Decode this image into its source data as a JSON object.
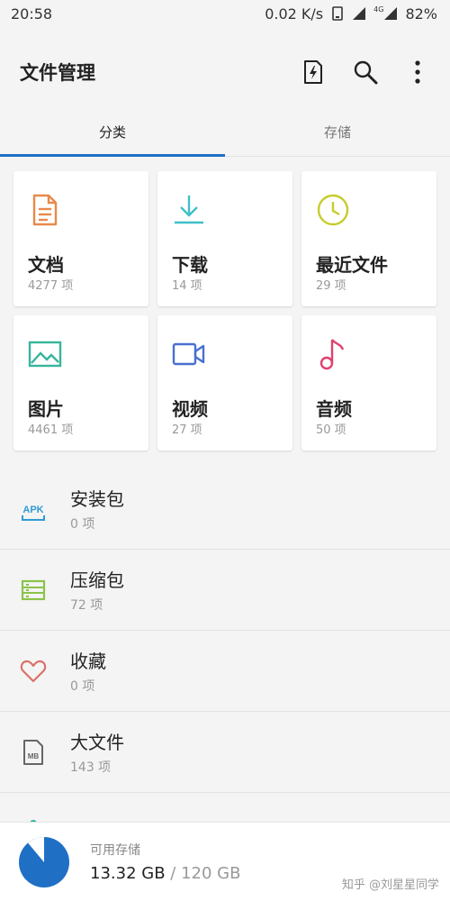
{
  "status_bar": {
    "time": "20:58",
    "speed": "0.02 K/s",
    "network": "4G",
    "battery": "82%"
  },
  "app_bar": {
    "title": "文件管理",
    "icons": [
      "flash-file-icon",
      "search-icon",
      "more-vert-icon"
    ]
  },
  "tabs": [
    {
      "label": "分类",
      "active": true
    },
    {
      "label": "存储",
      "active": false
    }
  ],
  "categories": [
    {
      "label": "文档",
      "count": "4277 项",
      "icon": "document-icon",
      "color": "#e8894a"
    },
    {
      "label": "下载",
      "count": "14 项",
      "icon": "download-icon",
      "color": "#3fbfc9"
    },
    {
      "label": "最近文件",
      "count": "29 项",
      "icon": "clock-icon",
      "color": "#c6cc2c"
    },
    {
      "label": "图片",
      "count": "4461 项",
      "icon": "image-icon",
      "color": "#36b59c"
    },
    {
      "label": "视频",
      "count": "27 项",
      "icon": "video-icon",
      "color": "#4a6fd1"
    },
    {
      "label": "音频",
      "count": "50 项",
      "icon": "music-icon",
      "color": "#e0416e"
    }
  ],
  "list": [
    {
      "label": "安装包",
      "count": "0 项",
      "icon": "apk-icon",
      "color": "#2f9bd6",
      "icon_text": "APK"
    },
    {
      "label": "压缩包",
      "count": "72 项",
      "icon": "archive-icon",
      "color": "#8bc34a"
    },
    {
      "label": "收藏",
      "count": "0 项",
      "icon": "heart-icon",
      "color": "#d9726a"
    },
    {
      "label": "大文件",
      "count": "143 项",
      "icon": "large-file-icon",
      "color": "#666666",
      "icon_text": "MB"
    }
  ],
  "storage": {
    "label": "可用存储",
    "used": "13.32 GB",
    "separator": " / ",
    "total": "120 GB",
    "available_fraction": 0.111,
    "color": "#1f6fc5"
  },
  "watermark": "知乎 @刘星星同学"
}
